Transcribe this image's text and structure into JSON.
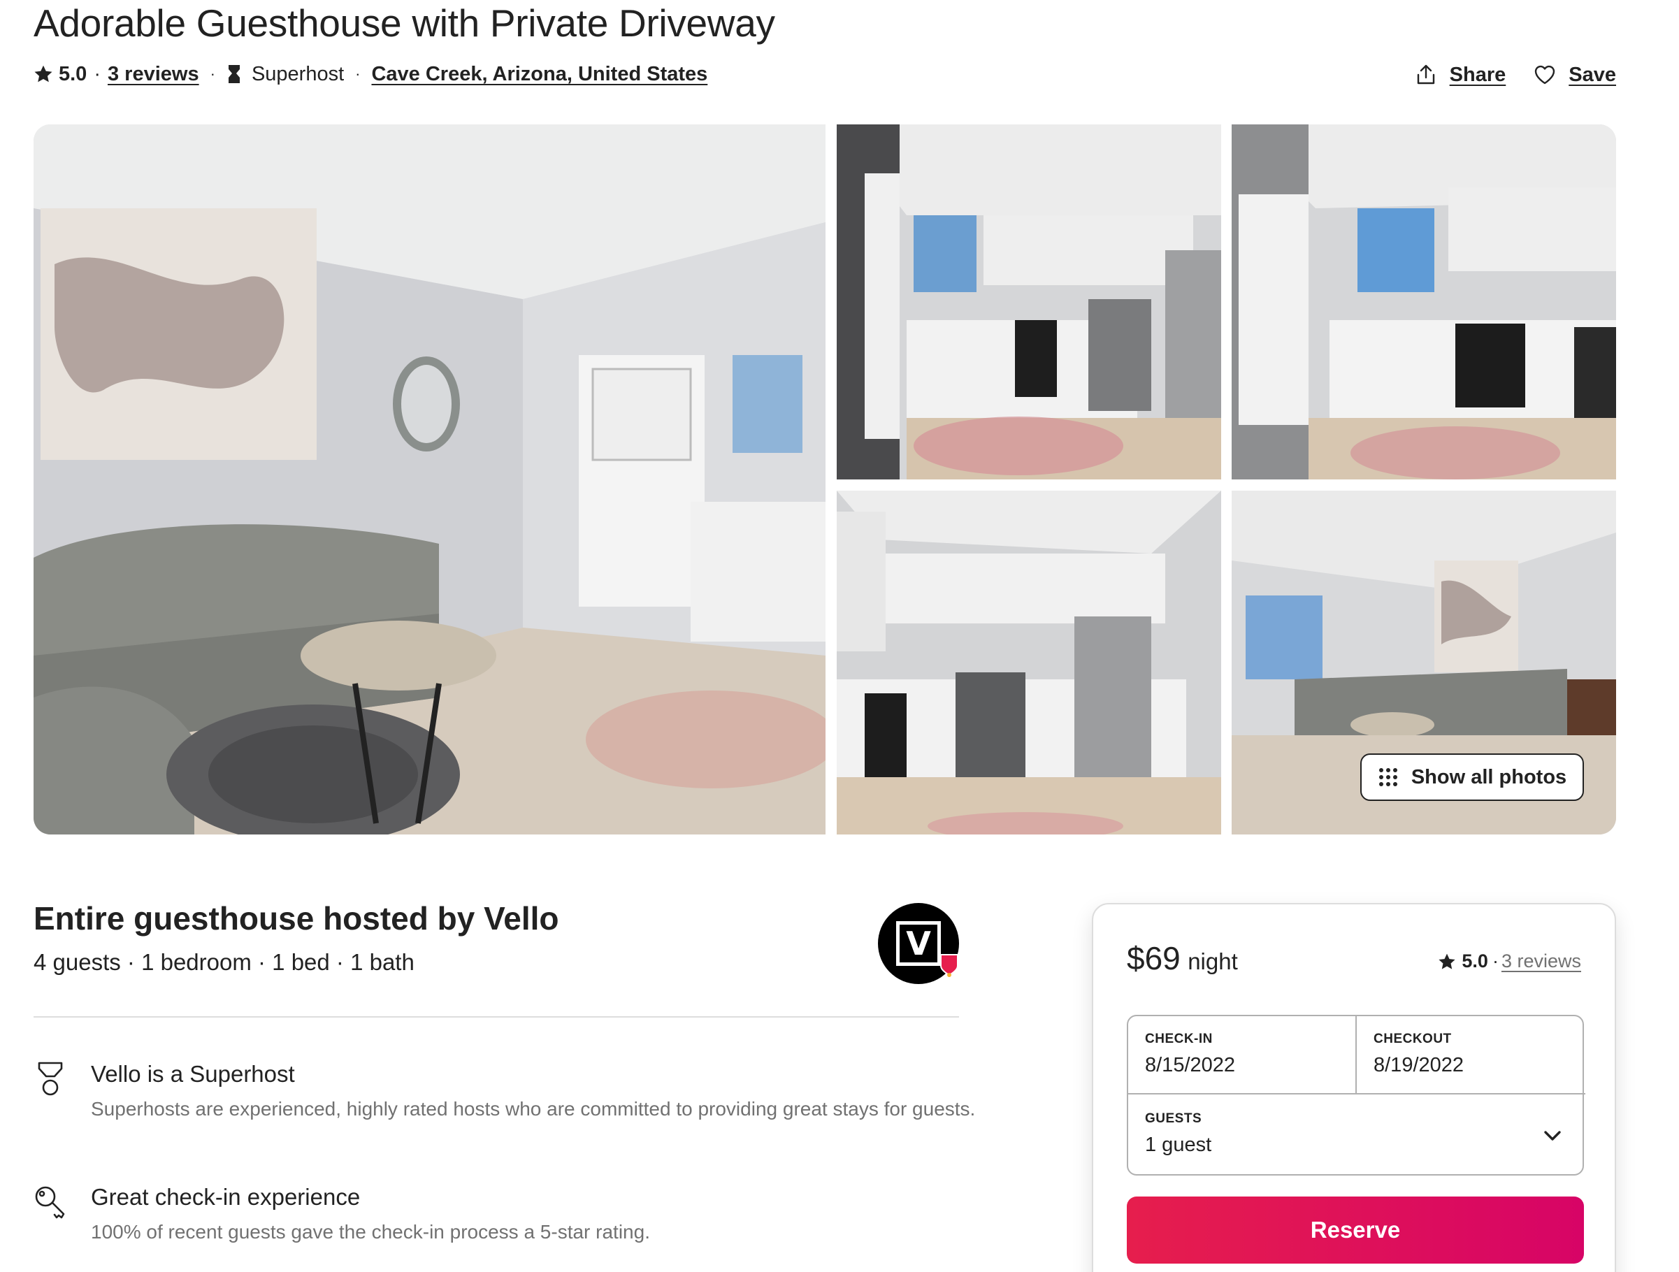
{
  "listing": {
    "title": "Adorable Guesthouse with Private Driveway",
    "rating": "5.0",
    "rating_sep": "·",
    "reviews": "3 reviews",
    "dot1": "·",
    "superhost": "Superhost",
    "dot2": "·",
    "location": "Cave Creek, Arizona, United States"
  },
  "actions": {
    "share": "Share",
    "save": "Save"
  },
  "gallery": {
    "show_all": "Show all photos",
    "photos": [
      "living room",
      "kitchen",
      "kitchen",
      "kitchen",
      "living room"
    ]
  },
  "host": {
    "title": "Entire guesthouse hosted by Vello",
    "details": "4 guests · 1 bedroom · 1 bed · 1 bath",
    "avatar_letter": "V"
  },
  "features": [
    {
      "icon": "medal-icon",
      "heading": "Vello is a Superhost",
      "body": "Superhosts are experienced, highly rated hosts who are committed to providing great stays for guests."
    },
    {
      "icon": "key-icon",
      "heading": "Great check-in experience",
      "body": "100% of recent guests gave the check-in process a 5-star rating."
    }
  ],
  "booking": {
    "price": "$69",
    "per": "night",
    "rating": "5.0",
    "rating_sep": "·",
    "reviews": "3 reviews",
    "checkin_label": "CHECK-IN",
    "checkin_value": "8/15/2022",
    "checkout_label": "CHECKOUT",
    "checkout_value": "8/19/2022",
    "guests_label": "GUESTS",
    "guests_value": "1 guest",
    "reserve": "Reserve"
  },
  "colors": {
    "text": "#222222",
    "muted": "#717171",
    "accent": "#e61e4d",
    "accent_end": "#d70466",
    "border": "#dddddd"
  }
}
